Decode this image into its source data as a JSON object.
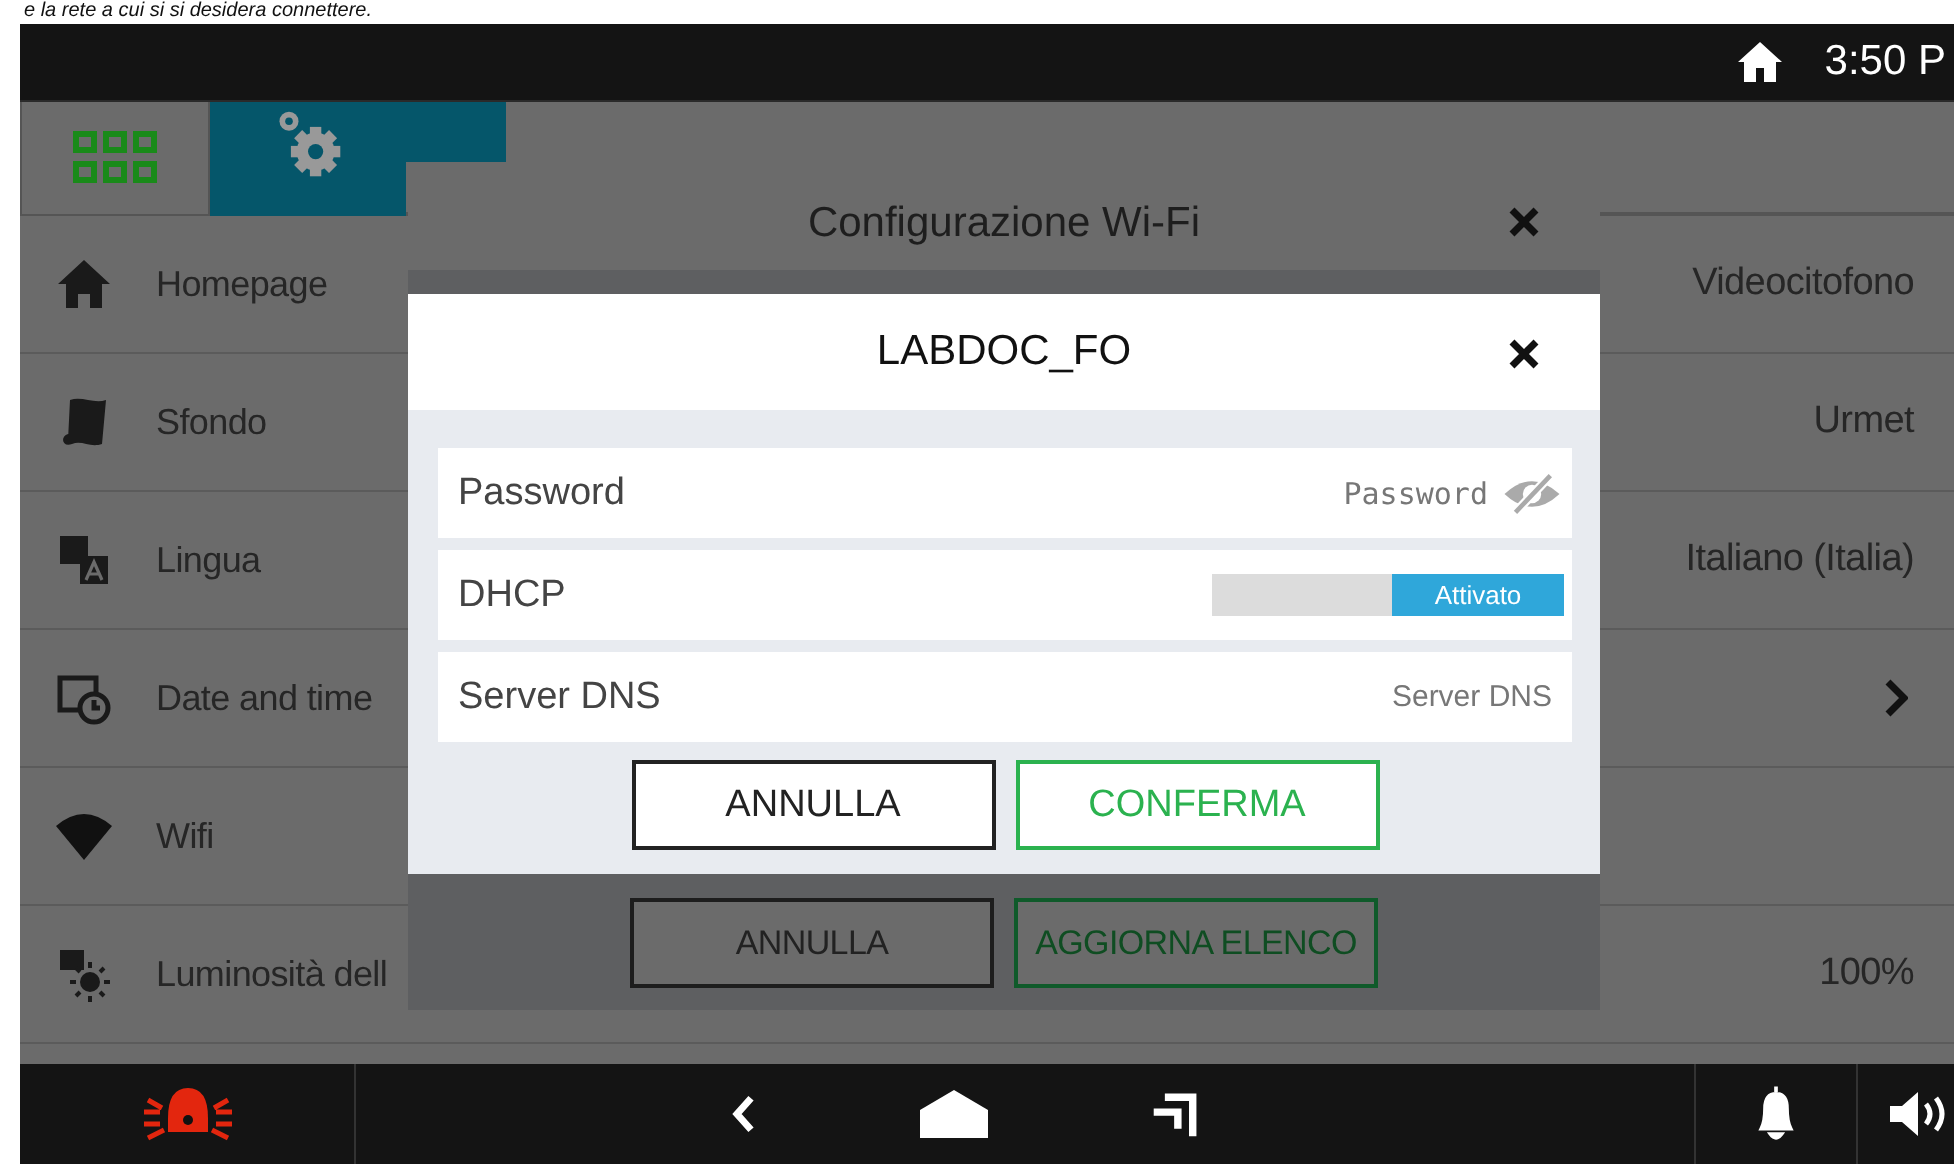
{
  "caption": "e la rete a cui si si desidera connettere.",
  "status_bar": {
    "time": "3:50 P"
  },
  "header_tabs": [
    {
      "kind": "grid",
      "selected": false
    },
    {
      "kind": "settings",
      "selected": true
    }
  ],
  "settings": [
    {
      "label": "Homepage",
      "kind": "value",
      "value": "Videocitofono"
    },
    {
      "label": "Sfondo",
      "kind": "value",
      "value": "Urmet"
    },
    {
      "label": "Lingua",
      "kind": "value",
      "value": "Italiano (Italia)"
    },
    {
      "label": "Date and time",
      "kind": "chevron"
    },
    {
      "label": "Wifi",
      "kind": "none"
    },
    {
      "label": "Luminosità dell",
      "kind": "value",
      "value": "100%"
    }
  ],
  "wifi_dialog": {
    "title": "Configurazione Wi-Fi",
    "buttons": [
      {
        "label": "ANNULLA",
        "kind": "cancel"
      },
      {
        "label": "AGGIORNA ELENCO",
        "kind": "confirm"
      }
    ]
  },
  "network_dialog": {
    "title": "LABDOC_FO",
    "fields": [
      {
        "kind": "password",
        "label": "Password",
        "placeholder": "Password"
      },
      {
        "kind": "toggle",
        "label": "DHCP",
        "on": true,
        "toggle_label": "Attivato"
      },
      {
        "kind": "text",
        "label": "Server DNS",
        "placeholder": "Server DNS"
      }
    ],
    "buttons": [
      {
        "label": "ANNULLA",
        "kind": "cancel"
      },
      {
        "label": "CONFERMA",
        "kind": "confirm"
      }
    ]
  }
}
